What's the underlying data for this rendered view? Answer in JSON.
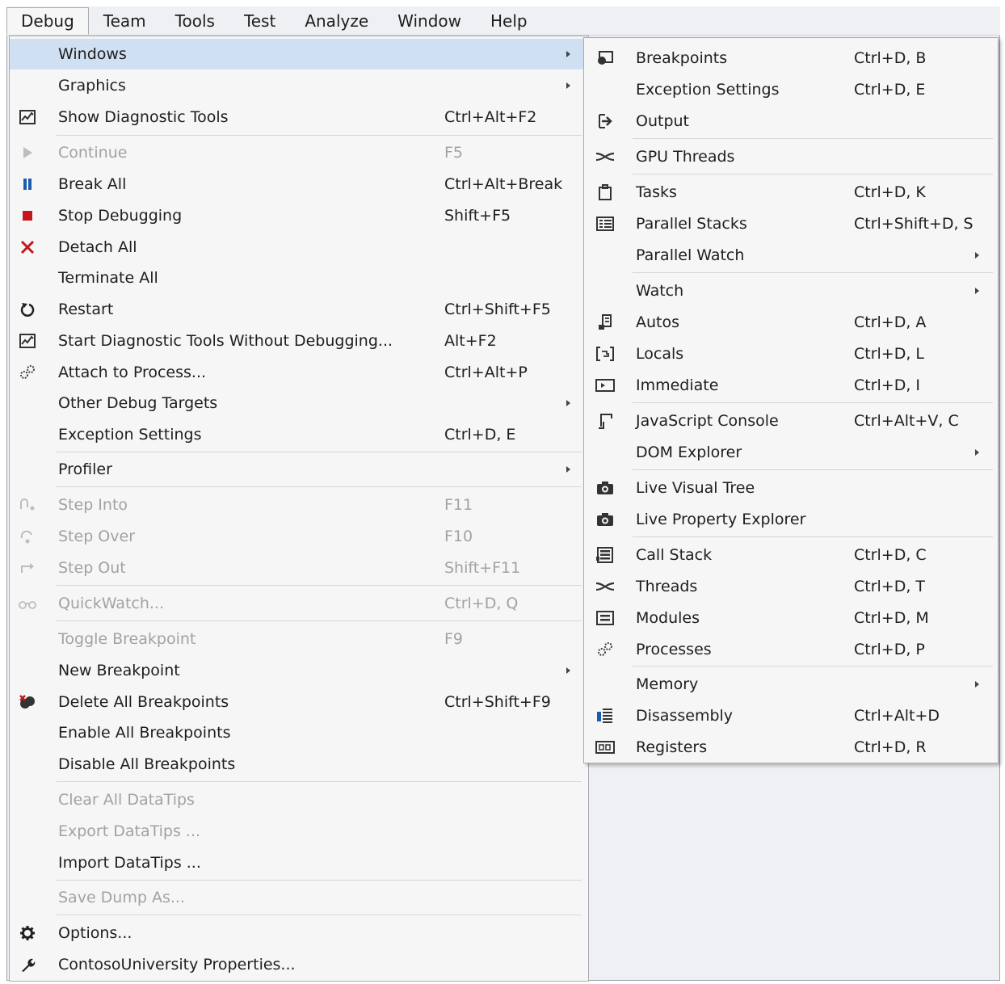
{
  "menubar": {
    "items": [
      "Debug",
      "Team",
      "Tools",
      "Test",
      "Analyze",
      "Window",
      "Help"
    ]
  },
  "debug_menu": {
    "items": [
      {
        "label": "Windows",
        "shortcut": "",
        "submenu": true,
        "highlighted": true
      },
      {
        "label": "Graphics",
        "shortcut": "",
        "submenu": true
      },
      {
        "label": "Show Diagnostic Tools",
        "shortcut": "Ctrl+Alt+F2",
        "icon": "diagnostic-tools-icon"
      },
      {
        "label": "Continue",
        "shortcut": "F5",
        "icon": "continue-icon",
        "disabled": true
      },
      {
        "label": "Break All",
        "shortcut": "Ctrl+Alt+Break",
        "icon": "pause-icon"
      },
      {
        "label": "Stop Debugging",
        "shortcut": "Shift+F5",
        "icon": "stop-icon"
      },
      {
        "label": "Detach All",
        "shortcut": "",
        "icon": "detach-icon"
      },
      {
        "label": "Terminate All",
        "shortcut": ""
      },
      {
        "label": "Restart",
        "shortcut": "Ctrl+Shift+F5",
        "icon": "restart-icon"
      },
      {
        "label": "Start Diagnostic Tools Without Debugging...",
        "shortcut": "Alt+F2",
        "icon": "diagnostic-tools-icon"
      },
      {
        "label": "Attach to Process...",
        "shortcut": "Ctrl+Alt+P",
        "icon": "gears-icon"
      },
      {
        "label": "Other Debug Targets",
        "shortcut": "",
        "submenu": true
      },
      {
        "label": "Exception Settings",
        "shortcut": "Ctrl+D, E"
      },
      {
        "label": "Profiler",
        "shortcut": "",
        "submenu": true
      },
      {
        "label": "Step Into",
        "shortcut": "F11",
        "icon": "step-into-icon",
        "disabled": true
      },
      {
        "label": "Step Over",
        "shortcut": "F10",
        "icon": "step-over-icon",
        "disabled": true
      },
      {
        "label": "Step Out",
        "shortcut": "Shift+F11",
        "icon": "step-out-icon",
        "disabled": true
      },
      {
        "label": "QuickWatch...",
        "shortcut": "Ctrl+D, Q",
        "icon": "glasses-icon",
        "disabled": true
      },
      {
        "label": "Toggle Breakpoint",
        "shortcut": "F9",
        "disabled": true
      },
      {
        "label": "New Breakpoint",
        "shortcut": "",
        "submenu": true
      },
      {
        "label": "Delete All Breakpoints",
        "shortcut": "Ctrl+Shift+F9",
        "icon": "delete-breakpoints-icon"
      },
      {
        "label": "Enable All Breakpoints",
        "shortcut": ""
      },
      {
        "label": "Disable All Breakpoints",
        "shortcut": ""
      },
      {
        "label": "Clear All DataTips",
        "shortcut": "",
        "disabled": true
      },
      {
        "label": "Export DataTips ...",
        "shortcut": "",
        "disabled": true
      },
      {
        "label": "Import DataTips ...",
        "shortcut": ""
      },
      {
        "label": "Save Dump As...",
        "shortcut": "",
        "disabled": true
      },
      {
        "label": "Options...",
        "shortcut": "",
        "icon": "gear-icon"
      },
      {
        "label": "ContosoUniversity Properties...",
        "shortcut": "",
        "icon": "wrench-icon"
      }
    ]
  },
  "windows_submenu": {
    "items": [
      {
        "label": "Breakpoints",
        "shortcut": "Ctrl+D, B",
        "icon": "breakpoints-icon"
      },
      {
        "label": "Exception Settings",
        "shortcut": "Ctrl+D, E"
      },
      {
        "label": "Output",
        "shortcut": "",
        "icon": "output-icon"
      },
      {
        "label": "GPU Threads",
        "shortcut": "",
        "icon": "threads-icon"
      },
      {
        "label": "Tasks",
        "shortcut": "Ctrl+D, K",
        "icon": "tasks-icon"
      },
      {
        "label": "Parallel Stacks",
        "shortcut": "Ctrl+Shift+D, S",
        "icon": "parallel-stacks-icon"
      },
      {
        "label": "Parallel Watch",
        "shortcut": "",
        "submenu": true
      },
      {
        "label": "Watch",
        "shortcut": "",
        "submenu": true
      },
      {
        "label": "Autos",
        "shortcut": "Ctrl+D, A",
        "icon": "autos-icon"
      },
      {
        "label": "Locals",
        "shortcut": "Ctrl+D, L",
        "icon": "locals-icon"
      },
      {
        "label": "Immediate",
        "shortcut": "Ctrl+D, I",
        "icon": "immediate-icon"
      },
      {
        "label": "JavaScript Console",
        "shortcut": "Ctrl+Alt+V, C",
        "icon": "console-icon"
      },
      {
        "label": "DOM Explorer",
        "shortcut": "",
        "submenu": true
      },
      {
        "label": "Live Visual Tree",
        "shortcut": "",
        "icon": "camera-icon"
      },
      {
        "label": "Live Property Explorer",
        "shortcut": "",
        "icon": "camera-icon"
      },
      {
        "label": "Call Stack",
        "shortcut": "Ctrl+D, C",
        "icon": "call-stack-icon"
      },
      {
        "label": "Threads",
        "shortcut": "Ctrl+D, T",
        "icon": "threads-icon"
      },
      {
        "label": "Modules",
        "shortcut": "Ctrl+D, M",
        "icon": "modules-icon"
      },
      {
        "label": "Processes",
        "shortcut": "Ctrl+D, P",
        "icon": "gears-icon"
      },
      {
        "label": "Memory",
        "shortcut": "",
        "submenu": true
      },
      {
        "label": "Disassembly",
        "shortcut": "Ctrl+Alt+D",
        "icon": "disassembly-icon"
      },
      {
        "label": "Registers",
        "shortcut": "Ctrl+D, R",
        "icon": "registers-icon"
      }
    ]
  }
}
